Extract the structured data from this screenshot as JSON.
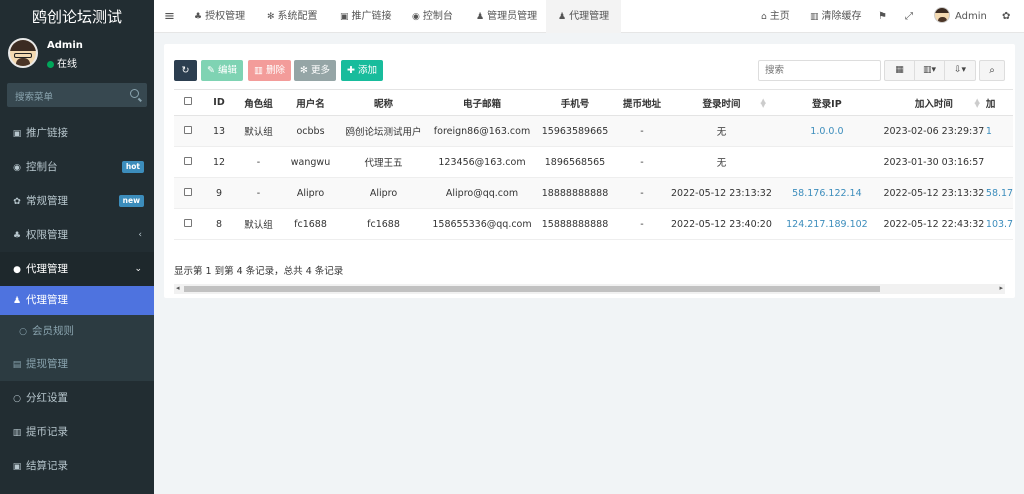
{
  "brand": "鸥创论坛测试",
  "user": {
    "name": "Admin",
    "status": "在线"
  },
  "sidebar": {
    "search_placeholder": "搜索菜单",
    "items": [
      {
        "label": "推广链接",
        "icon": "link-icon"
      },
      {
        "label": "控制台",
        "icon": "dashboard-icon",
        "badge": "hot"
      },
      {
        "label": "常规管理",
        "icon": "cogs-icon",
        "badge": "new"
      },
      {
        "label": "权限管理",
        "icon": "group-icon"
      },
      {
        "label": "代理管理",
        "icon": "user-circle-icon"
      },
      {
        "label": "代理管理",
        "icon": "user-icon"
      },
      {
        "label": "会员规则",
        "icon": "circle-icon"
      },
      {
        "label": "提现管理",
        "icon": "list-icon"
      },
      {
        "label": "分红设置",
        "icon": "circle-icon"
      },
      {
        "label": "提币记录",
        "icon": "bars-icon"
      },
      {
        "label": "结算记录",
        "icon": "list-icon"
      }
    ]
  },
  "topbar": {
    "tabs": [
      "授权管理",
      "系统配置",
      "推广链接",
      "控制台",
      "管理员管理",
      "代理管理"
    ],
    "home": "主页",
    "clear_cache": "清除缓存",
    "admin": "Admin"
  },
  "toolbar": {
    "edit": "编辑",
    "delete": "删除",
    "more": "更多",
    "add": "添加",
    "search_placeholder": "搜索"
  },
  "table": {
    "headers": [
      "ID",
      "角色组",
      "用户名",
      "昵称",
      "电子邮箱",
      "手机号",
      "提币地址",
      "登录时间",
      "登录IP",
      "加入时间",
      "加"
    ],
    "rows": [
      [
        "13",
        "默认组",
        "ocbbs",
        "鸥创论坛测试用户",
        "foreign86@163.com",
        "15963589665",
        "-",
        "无",
        "1.0.0.0",
        "2023-02-06 23:29:37",
        "1"
      ],
      [
        "12",
        "-",
        "wangwu",
        "代理王五",
        "123456@163.com",
        "1896568565",
        "-",
        "无",
        "",
        "2023-01-30 03:16:57",
        ""
      ],
      [
        "9",
        "-",
        "Alipro",
        "Alipro",
        "Alipro@qq.com",
        "18888888888",
        "-",
        "2022-05-12 23:13:32",
        "58.176.122.14",
        "2022-05-12 23:13:32",
        "58.17"
      ],
      [
        "8",
        "默认组",
        "fc1688",
        "fc1688",
        "158655336@qq.com",
        "15888888888",
        "-",
        "2022-05-12 23:40:20",
        "124.217.189.102",
        "2022-05-12 22:43:32",
        "103.7"
      ]
    ]
  },
  "footer": "显示第 1 到第 4 条记录，总共 4 条记录",
  "colors": {
    "sidebar": "#222d32",
    "active": "#4e73df",
    "link": "#3c8dbc"
  }
}
